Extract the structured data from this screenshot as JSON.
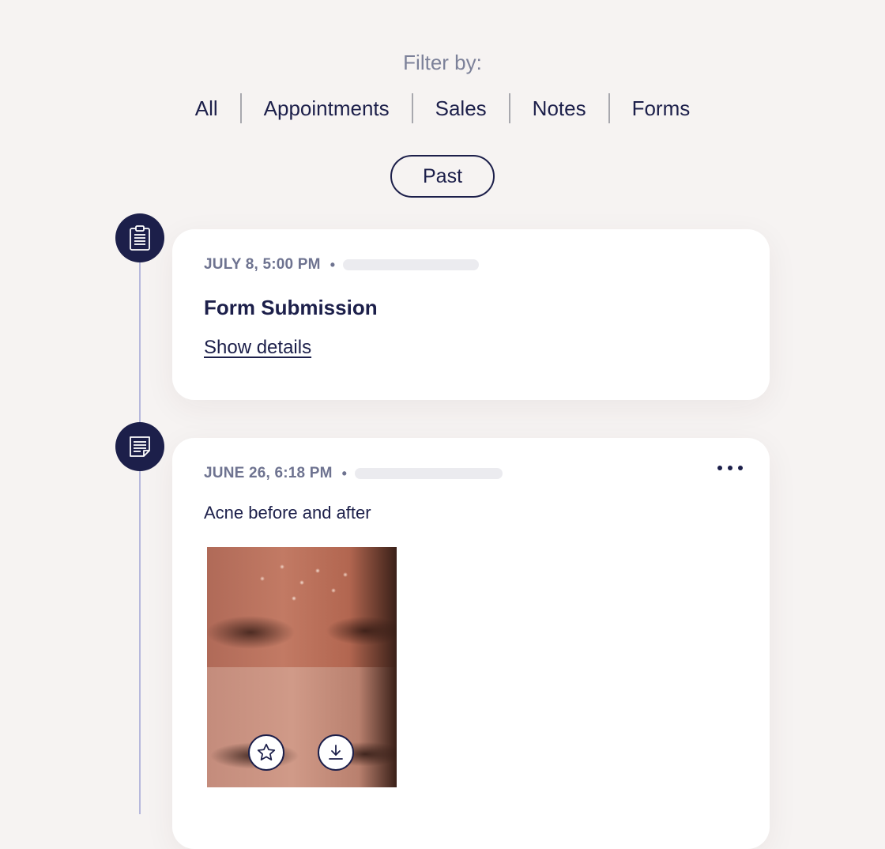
{
  "filter": {
    "label": "Filter by:",
    "tabs": [
      "All",
      "Appointments",
      "Sales",
      "Notes",
      "Forms"
    ]
  },
  "period_toggle": {
    "label": "Past"
  },
  "entries": [
    {
      "type": "form",
      "icon": "clipboard-icon",
      "timestamp": "JULY 8, 5:00 PM",
      "title": "Form Submission",
      "link": "Show details"
    },
    {
      "type": "note",
      "icon": "note-icon",
      "timestamp": "JUNE 26, 6:18 PM",
      "text": "Acne before and after",
      "photo_actions": [
        "star-icon",
        "download-icon"
      ]
    }
  ],
  "colors": {
    "background": "#f6f3f2",
    "primary": "#1c1f4a",
    "muted": "#6e7390",
    "timeline": "#b6b8dc",
    "card": "#ffffff"
  }
}
